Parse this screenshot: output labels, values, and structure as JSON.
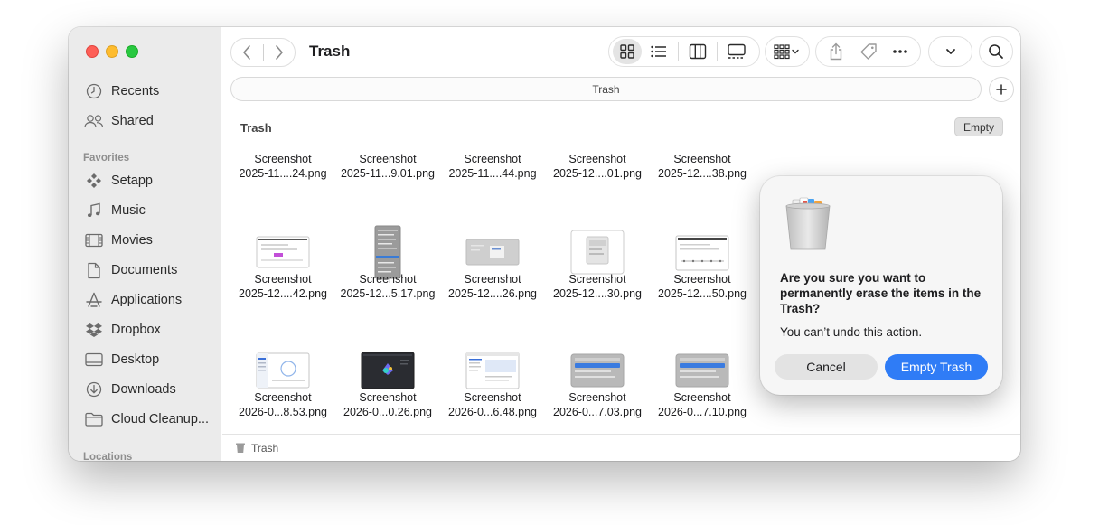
{
  "window": {
    "title": "Trash"
  },
  "sidebar": {
    "top_items": [
      {
        "label": "Recents",
        "icon": "clock-icon"
      },
      {
        "label": "Shared",
        "icon": "shared-icon"
      }
    ],
    "favorites_header": "Favorites",
    "favorites": [
      {
        "label": "Setapp",
        "icon": "setapp-icon"
      },
      {
        "label": "Music",
        "icon": "music-note-icon"
      },
      {
        "label": "Movies",
        "icon": "film-icon"
      },
      {
        "label": "Documents",
        "icon": "document-icon"
      },
      {
        "label": "Applications",
        "icon": "applications-icon"
      },
      {
        "label": "Dropbox",
        "icon": "dropbox-icon"
      },
      {
        "label": "Desktop",
        "icon": "desktop-icon"
      },
      {
        "label": "Downloads",
        "icon": "download-icon"
      },
      {
        "label": "Cloud Cleanup...",
        "icon": "folder-icon"
      }
    ],
    "locations_header": "Locations"
  },
  "pathbar": {
    "label": "Trash"
  },
  "content": {
    "header": "Trash",
    "empty_button": "Empty"
  },
  "files": [
    {
      "line1": "Screenshot",
      "line2": "2025-11....24.png",
      "thumb": "none"
    },
    {
      "line1": "Screenshot",
      "line2": "2025-11...9.01.png",
      "thumb": "none"
    },
    {
      "line1": "Screenshot",
      "line2": "2025-11....44.png",
      "thumb": "none"
    },
    {
      "line1": "Screenshot",
      "line2": "2025-12....01.png",
      "thumb": "none"
    },
    {
      "line1": "Screenshot",
      "line2": "2025-12....38.png",
      "thumb": "none"
    },
    {
      "line1": "Screenshot",
      "line2": "2025-12....42.png",
      "thumb": "wide-doc"
    },
    {
      "line1": "Screenshot",
      "line2": "2025-12...5.17.png",
      "thumb": "tall-menu"
    },
    {
      "line1": "Screenshot",
      "line2": "2025-12....26.png",
      "thumb": "gray-panel"
    },
    {
      "line1": "Screenshot",
      "line2": "2025-12....30.png",
      "thumb": "small-window"
    },
    {
      "line1": "Screenshot",
      "line2": "2025-12....50.png",
      "thumb": "timeline"
    },
    {
      "line1": "Screenshot",
      "line2": "2026-0...8.53.png",
      "thumb": "app-window"
    },
    {
      "line1": "Screenshot",
      "line2": "2026-0...0.26.png",
      "thumb": "dark-app"
    },
    {
      "line1": "Screenshot",
      "line2": "2026-0...6.48.png",
      "thumb": "list-window"
    },
    {
      "line1": "Screenshot",
      "line2": "2026-0...7.03.png",
      "thumb": "menu-blue"
    },
    {
      "line1": "Screenshot",
      "line2": "2026-0...7.10.png",
      "thumb": "menu-blue"
    }
  ],
  "bottombar": {
    "label": "Trash"
  },
  "dialog": {
    "title": "Are you sure you want to permanently erase the items in the Trash?",
    "message": "You can’t undo this action.",
    "cancel_label": "Cancel",
    "confirm_label": "Empty Trash",
    "accent": "#2f7cf6"
  }
}
